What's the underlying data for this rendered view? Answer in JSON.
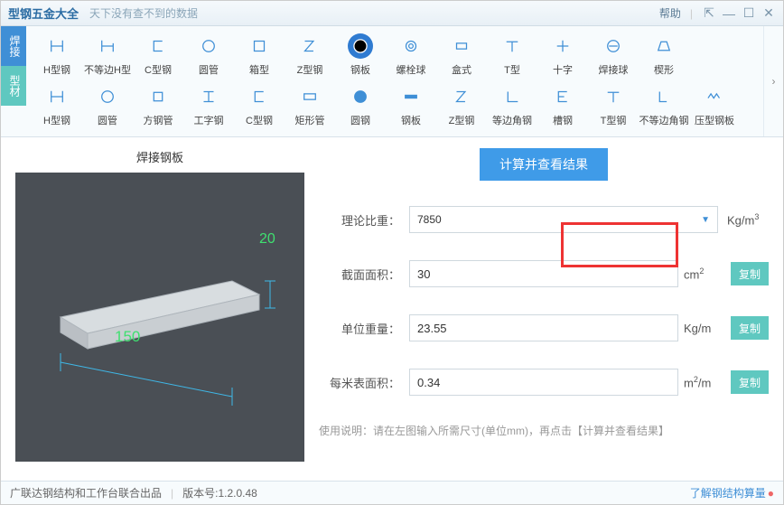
{
  "title": "型钢五金大全",
  "subtitle": "天下没有查不到的数据",
  "help": "帮助",
  "vtabs": {
    "weld": "焊接",
    "section": "型材"
  },
  "row1": [
    {
      "id": "h",
      "label": "H型钢",
      "sel": false
    },
    {
      "id": "uh",
      "label": "不等边H型",
      "sel": false
    },
    {
      "id": "c",
      "label": "C型钢",
      "sel": false
    },
    {
      "id": "ring",
      "label": "圆管",
      "sel": false
    },
    {
      "id": "box",
      "label": "箱型",
      "sel": false
    },
    {
      "id": "z",
      "label": "Z型钢",
      "sel": false
    },
    {
      "id": "plate",
      "label": "钢板",
      "sel": true
    },
    {
      "id": "bolt",
      "label": "螺栓球",
      "sel": false
    },
    {
      "id": "hex",
      "label": "盒式",
      "sel": false
    },
    {
      "id": "t",
      "label": "T型",
      "sel": false
    },
    {
      "id": "cross",
      "label": "十字",
      "sel": false
    },
    {
      "id": "wball",
      "label": "焊接球",
      "sel": false
    },
    {
      "id": "wedge",
      "label": "楔形",
      "sel": false
    }
  ],
  "row2": [
    {
      "id": "h2",
      "label": "H型钢"
    },
    {
      "id": "rp",
      "label": "圆管"
    },
    {
      "id": "sq",
      "label": "方钢管"
    },
    {
      "id": "i",
      "label": "工字钢"
    },
    {
      "id": "c2",
      "label": "C型钢"
    },
    {
      "id": "rect",
      "label": "矩形管"
    },
    {
      "id": "rod",
      "label": "圆钢"
    },
    {
      "id": "pl2",
      "label": "钢板"
    },
    {
      "id": "z2",
      "label": "Z型钢"
    },
    {
      "id": "ang",
      "label": "等边角钢"
    },
    {
      "id": "ch",
      "label": "槽钢"
    },
    {
      "id": "t2",
      "label": "T型钢"
    },
    {
      "id": "uang",
      "label": "不等边角钢"
    },
    {
      "id": "press",
      "label": "压型钢板"
    }
  ],
  "left_title": "焊接钢板",
  "dims": {
    "w": "150",
    "t": "20"
  },
  "calc_button": "计算并查看结果",
  "fields": {
    "density_label": "理论比重：",
    "density_value": "7850",
    "density_unit": "Kg/m³",
    "area_label": "截面面积：",
    "area_value": "30",
    "area_unit": "cm²",
    "weight_label": "单位重量：",
    "weight_value": "23.55",
    "weight_unit": "Kg/m",
    "surface_label": "每米表面积：",
    "surface_value": "0.34",
    "surface_unit": "m²/m"
  },
  "copy": "复制",
  "note": "使用说明：请在左图输入所需尺寸(单位mm)，再点击【计算并查看结果】",
  "status": {
    "left1": "广联达钢结构和工作台联合出品",
    "left2": "版本号:1.2.0.48",
    "link": "了解钢结构算量"
  }
}
